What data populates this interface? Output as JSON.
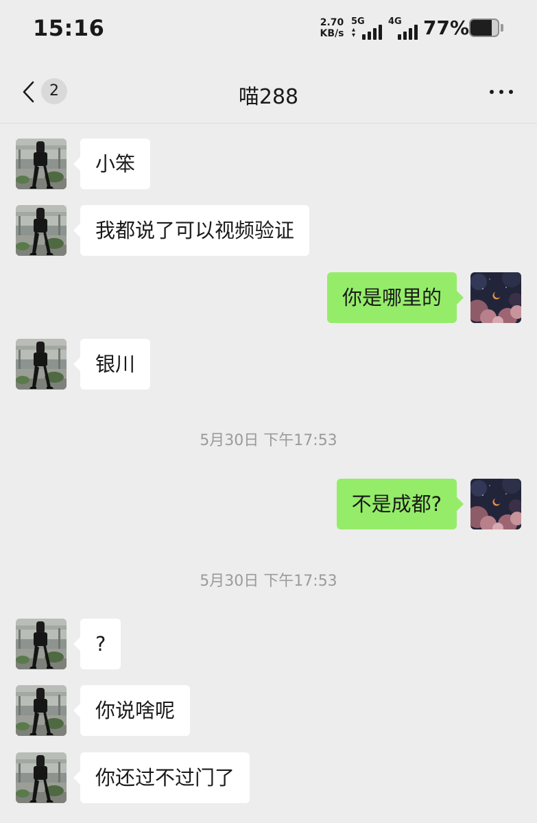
{
  "status_bar": {
    "time": "15:16",
    "net_speed_value": "2.70",
    "net_speed_unit": "KB/s",
    "network_1": "5G",
    "network_2": "4G",
    "battery_text": "77%",
    "battery_level": 0.77,
    "icons": [
      "5g-signal-icon",
      "4g-signal-icon",
      "battery-icon"
    ]
  },
  "header": {
    "unread_count": "2",
    "title": "喵288",
    "icons": [
      "back-chevron-icon",
      "more-icon"
    ]
  },
  "colors": {
    "background": "#ededed",
    "outgoing_bubble": "#95ec69",
    "incoming_bubble": "#ffffff",
    "timestamp_text": "#9a9a9a"
  },
  "messages": [
    {
      "side": "left",
      "text": "小笨"
    },
    {
      "side": "left",
      "text": "我都说了可以视频验证"
    },
    {
      "side": "right",
      "text": "你是哪里的"
    },
    {
      "side": "left",
      "text": "银川"
    },
    {
      "type": "time",
      "text": "5月30日 下午17:53"
    },
    {
      "side": "right",
      "text": "不是成都?"
    },
    {
      "type": "time",
      "text": "5月30日 下午17:53"
    },
    {
      "side": "left",
      "text": "?"
    },
    {
      "side": "left",
      "text": "你说啥呢"
    },
    {
      "side": "left",
      "text": "你还过不过门了"
    }
  ]
}
